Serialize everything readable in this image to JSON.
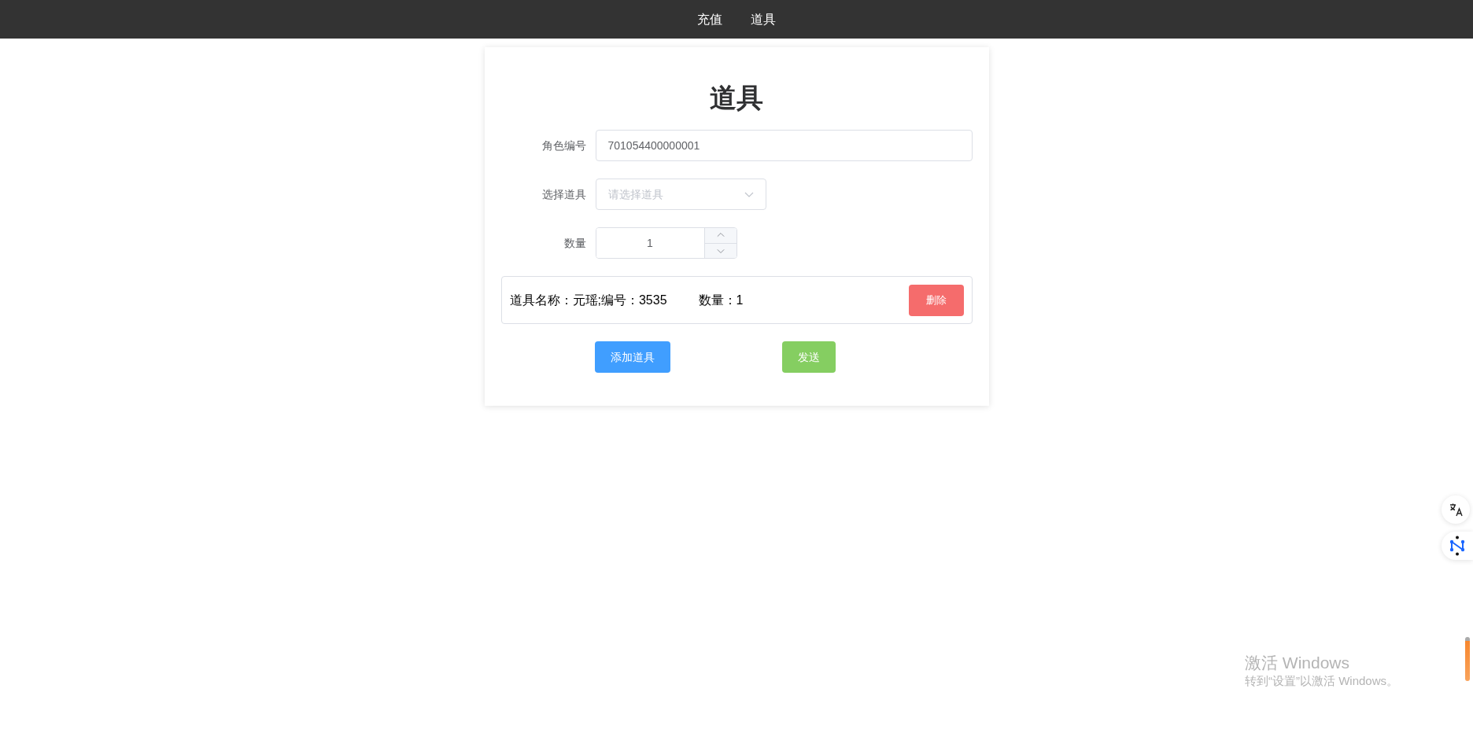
{
  "nav": {
    "items": [
      {
        "label": "充值"
      },
      {
        "label": "道具"
      }
    ]
  },
  "form": {
    "title": "道具",
    "fields": [
      {
        "kind": "text",
        "label": "角色编号",
        "value": "701054400000001"
      },
      {
        "kind": "select",
        "label": "选择道具",
        "placeholder": "请选择道具"
      },
      {
        "kind": "number",
        "label": "数量",
        "value": "1"
      }
    ],
    "items": [
      {
        "name_text": "道具名称：元瑶;编号：3535",
        "quantity_text": "数量：1",
        "delete_label": "删除"
      }
    ],
    "buttons": [
      {
        "kind": "primary",
        "label": "添加道具"
      },
      {
        "kind": "success",
        "label": "发送"
      }
    ]
  },
  "watermark": {
    "title": "激活 Windows",
    "subtitle": "转到“设置”以激活 Windows。"
  }
}
